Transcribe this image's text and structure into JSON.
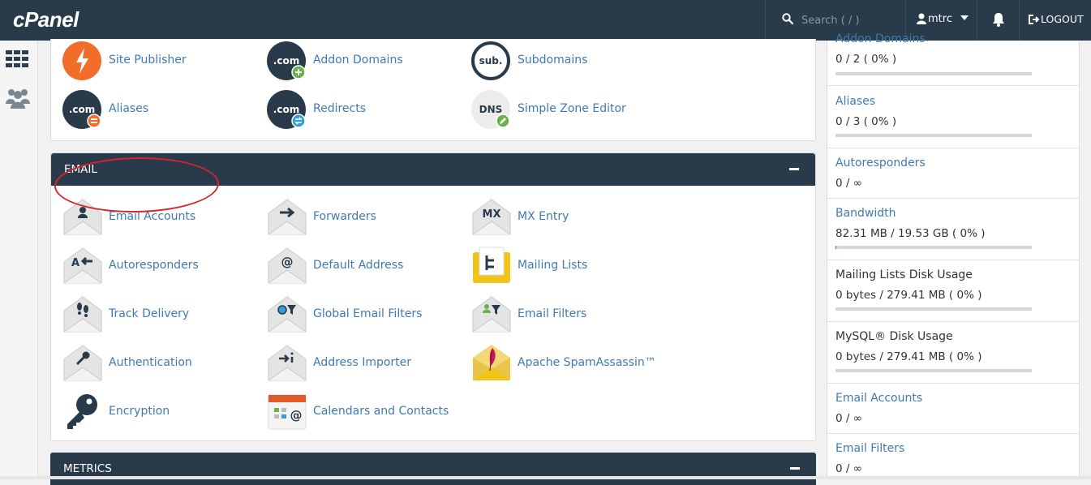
{
  "header": {
    "logo": "cPanel",
    "search_placeholder": "Search ( / )",
    "user": "mtrc",
    "logout": "LOGOUT"
  },
  "top_section": {
    "items": [
      {
        "label": "Site Publisher",
        "icon": "lightning-icon"
      },
      {
        "label": "Addon Domains",
        "icon": "dotcom-plus-icon"
      },
      {
        "label": "Subdomains",
        "icon": "sub-icon"
      },
      {
        "label": "Aliases",
        "icon": "dotcom-equals-icon"
      },
      {
        "label": "Redirects",
        "icon": "dotcom-redirect-icon"
      },
      {
        "label": "Simple Zone Editor",
        "icon": "dns-edit-icon"
      }
    ]
  },
  "email_section": {
    "title": "EMAIL",
    "items": [
      {
        "label": "Email Accounts",
        "icon": "envelope-user-icon"
      },
      {
        "label": "Forwarders",
        "icon": "envelope-arrow-icon"
      },
      {
        "label": "MX Entry",
        "icon": "envelope-mx-icon"
      },
      {
        "label": "Autoresponders",
        "icon": "envelope-reply-icon"
      },
      {
        "label": "Default Address",
        "icon": "envelope-at-icon"
      },
      {
        "label": "Mailing Lists",
        "icon": "mailing-list-icon"
      },
      {
        "label": "Track Delivery",
        "icon": "envelope-footprints-icon"
      },
      {
        "label": "Global Email Filters",
        "icon": "envelope-globe-filter-icon"
      },
      {
        "label": "Email Filters",
        "icon": "envelope-user-filter-icon"
      },
      {
        "label": "Authentication",
        "icon": "envelope-key-icon"
      },
      {
        "label": "Address Importer",
        "icon": "envelope-import-icon"
      },
      {
        "label": "Apache SpamAssassin™",
        "icon": "spamassassin-feather-icon"
      },
      {
        "label": "Encryption",
        "icon": "key-icon"
      },
      {
        "label": "Calendars and Contacts",
        "icon": "calendar-icon"
      }
    ]
  },
  "metrics_section": {
    "title": "METRICS"
  },
  "stats": [
    {
      "title": "Addon Domains",
      "value": "0 / 2 ( 0% )",
      "link": true,
      "fraction": 0
    },
    {
      "title": "Aliases",
      "value": "0 / 3 ( 0% )",
      "link": true,
      "fraction": 0
    },
    {
      "title": "Autoresponders",
      "value": "0 / ∞",
      "link": true
    },
    {
      "title": "Bandwidth",
      "value": "82.31 MB / 19.53 GB ( 0% )",
      "link": true,
      "fraction": 0.004
    },
    {
      "title": "Mailing Lists Disk Usage",
      "value": "0 bytes / 279.41 MB ( 0% )",
      "link": false,
      "fraction": 0
    },
    {
      "title": "MySQL® Disk Usage",
      "value": "0 bytes / 279.41 MB ( 0% )",
      "link": false,
      "fraction": 0
    },
    {
      "title": "Email Accounts",
      "value": "0 / ∞",
      "link": true
    },
    {
      "title": "Email Filters",
      "value": "0 / ∞",
      "link": true
    }
  ],
  "colors": {
    "header_bg": "#293a4a",
    "link": "#3f7ab3",
    "annotation": "#d8242a",
    "site_publisher": "#f26c2a"
  }
}
